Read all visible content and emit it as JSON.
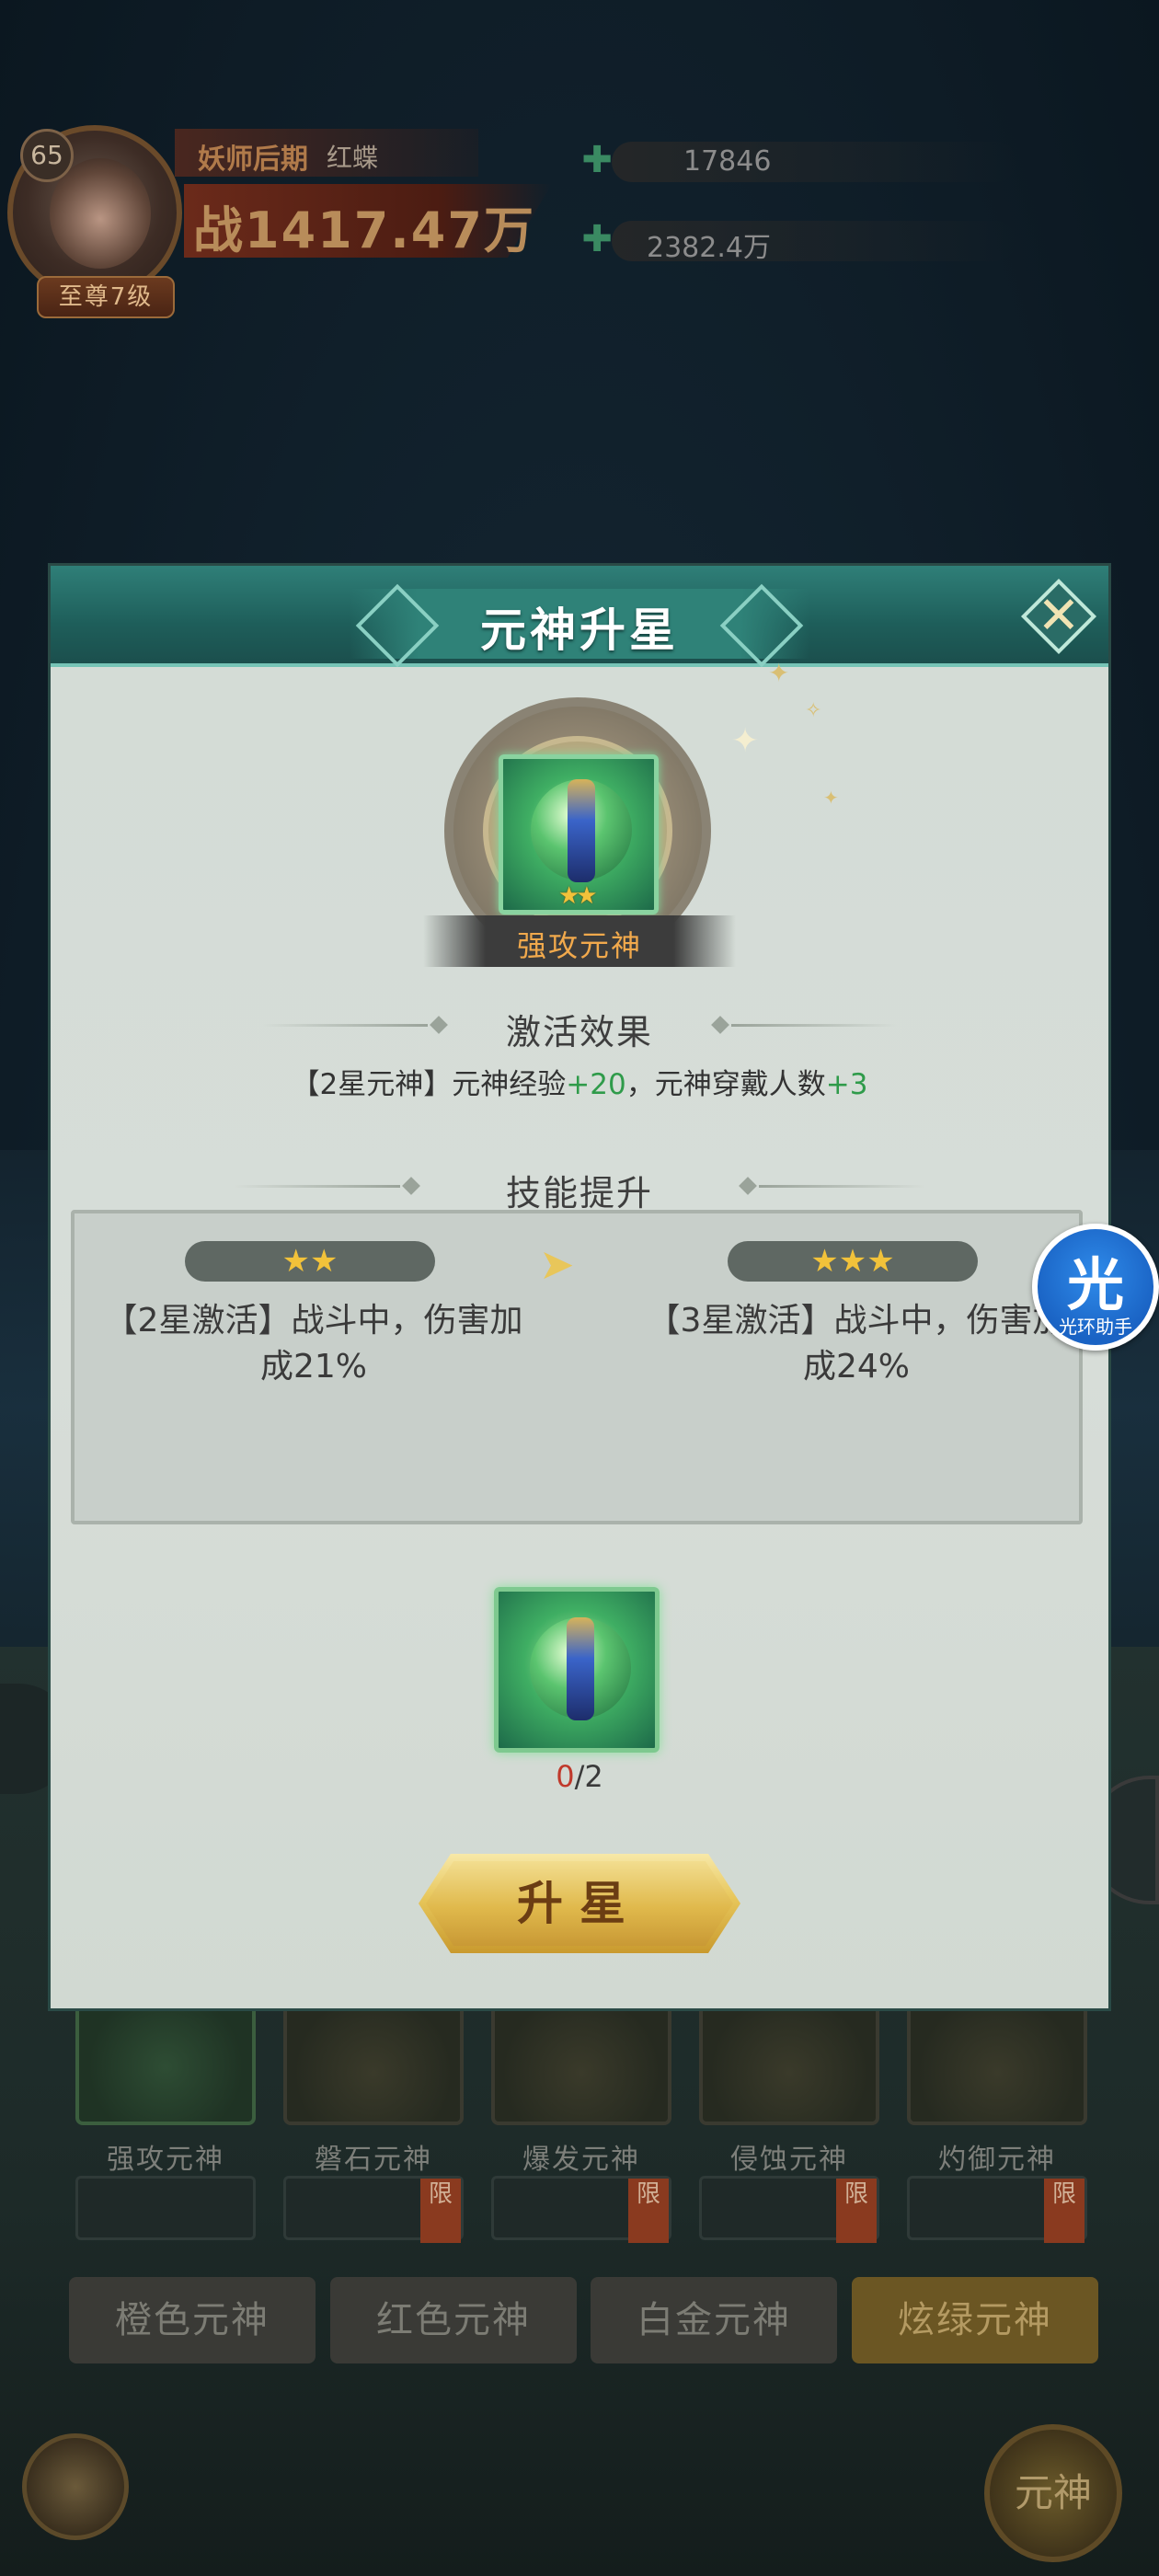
{
  "player": {
    "level": "65",
    "rank_title": "妖师后期",
    "name": "红蝶",
    "power": "战1417.47万",
    "vip": "至尊7级"
  },
  "currencies": [
    {
      "icon": "jade-icon",
      "value": "17846"
    },
    {
      "icon": "crystal-icon",
      "value": "2382.4万"
    }
  ],
  "modal": {
    "title": "元神升星",
    "close_icon": "close-icon",
    "hero": {
      "name": "强攻元神",
      "stars": "★★"
    },
    "activation": {
      "heading": "激活效果",
      "prefix": "【2星元神】元神经验",
      "exp_bonus": "+20",
      "mid": "，元神穿戴人数",
      "wear_bonus": "+3"
    },
    "skill": {
      "heading": "技能提升",
      "current_stars": "★★",
      "current_text": "【2星激活】战斗中，伤害加成21%",
      "next_stars": "★★★",
      "next_text": "【3星激活】战斗中，伤害加成24%",
      "arrow": "➤"
    },
    "material": {
      "current": "0",
      "required": "/2"
    },
    "upgrade_button": "升星"
  },
  "background": {
    "spirits": [
      "强攻元神",
      "磐石元神",
      "爆发元神",
      "侵蚀元神",
      "灼御元神"
    ],
    "limit_tag": "限",
    "tabs": [
      "橙色元神",
      "红色元神",
      "白金元神",
      "炫绿元神"
    ],
    "active_tab": "炫绿元神",
    "bottom_right_label": "元神"
  },
  "assistant": {
    "glyph": "光",
    "label": "光环助手"
  },
  "colors": {
    "header_teal": "#1e5e5a",
    "bonus_green": "#2f9b4a",
    "hero_name_orange": "#f1a94c",
    "count_red": "#c0392b",
    "button_gold": "#e0b94c"
  }
}
